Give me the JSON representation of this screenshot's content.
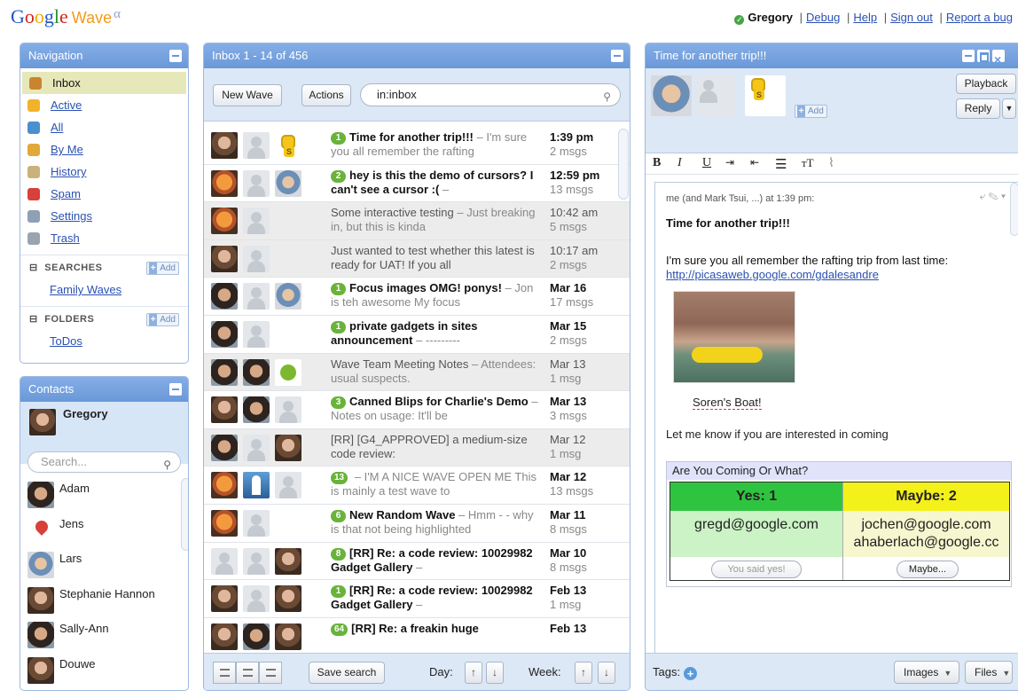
{
  "app": {
    "logo": {
      "g1": "G",
      "g2": "o",
      "g3": "o",
      "g4": "g",
      "g5": "l",
      "g6": "e",
      "wave": "Wave",
      "alpha": "α"
    },
    "user": "Gregory",
    "links": [
      "Debug",
      "Help",
      "Sign out",
      "Report a bug"
    ]
  },
  "nav": {
    "title": "Navigation",
    "items": [
      {
        "label": "Inbox",
        "icon": "inbox-icon",
        "color": "#c8842e"
      },
      {
        "label": "Active",
        "icon": "lightning-icon",
        "color": "#f2b32a"
      },
      {
        "label": "All",
        "icon": "globe-icon",
        "color": "#4a90d0"
      },
      {
        "label": "By Me",
        "icon": "pencil-icon",
        "color": "#e0a93a"
      },
      {
        "label": "History",
        "icon": "clock-icon",
        "color": "#c9b37a"
      },
      {
        "label": "Spam",
        "icon": "no-entry-icon",
        "color": "#d8403a"
      },
      {
        "label": "Settings",
        "icon": "wrench-icon",
        "color": "#8fa0b6"
      },
      {
        "label": "Trash",
        "icon": "trash-icon",
        "color": "#9aa4ae"
      }
    ],
    "searches_label": "SEARCHES",
    "searches": [
      "Family Waves"
    ],
    "folders_label": "FOLDERS",
    "folders": [
      "ToDos"
    ],
    "add_label": "Add"
  },
  "contacts": {
    "title": "Contacts",
    "me": "Gregory",
    "search_placeholder": "Search...",
    "list": [
      "Adam",
      "Jens",
      "Lars",
      "Stephanie Hannon",
      "Sally-Ann",
      "Douwe"
    ]
  },
  "inbox": {
    "title": "Inbox 1 - 14 of 456",
    "new_wave": "New Wave",
    "actions": "Actions",
    "query": "in:inbox",
    "waves": [
      {
        "badge": "1",
        "title": "Time for another trip!!!",
        "snippet": " – I'm sure you all remember the rafting",
        "time": "1:39 pm",
        "msgs": "2 msgs",
        "read": false
      },
      {
        "badge": "2",
        "title": "hey is this the demo of cursors? I can't see a cursor :(",
        "snippet": " –",
        "time": "12:59 pm",
        "msgs": "13 msgs",
        "read": false
      },
      {
        "badge": "",
        "title": "Some interactive testing",
        "snippet": " – Just breaking in, but this is kinda",
        "time": "10:42 am",
        "msgs": "5 msgs",
        "read": true
      },
      {
        "badge": "",
        "title": "Just wanted to test whether this latest is ready for UAT! If you all",
        "snippet": "",
        "time": "10:17 am",
        "msgs": "2 msgs",
        "read": true
      },
      {
        "badge": "1",
        "title": "Focus images OMG! ponys!",
        "snippet": " – Jon is teh awesome My focus",
        "time": "Mar 16",
        "msgs": "17 msgs",
        "read": false
      },
      {
        "badge": "1",
        "title": "private gadgets in sites announcement",
        "snippet": " – ---------",
        "time": "Mar 15",
        "msgs": "2 msgs",
        "read": false
      },
      {
        "badge": "",
        "title": "Wave Team Meeting Notes",
        "snippet": " – Attendees: usual suspects.",
        "time": "Mar 13",
        "msgs": "1 msg",
        "read": true
      },
      {
        "badge": "3",
        "title": "Canned Blips for Charlie's Demo",
        "snippet": " – Notes on usage: It'll be",
        "time": "Mar 13",
        "msgs": "3 msgs",
        "read": false
      },
      {
        "badge": "",
        "title": "[RR] [G4_APPROVED] a medium-size code review:",
        "snippet": "",
        "time": "Mar 12",
        "msgs": "1 msg",
        "read": true
      },
      {
        "badge": "13",
        "title": "",
        "snippet": " – I'M A NICE WAVE OPEN ME This is mainly a test wave to",
        "time": "Mar 12",
        "msgs": "13 msgs",
        "read": false
      },
      {
        "badge": "6",
        "title": "New Random Wave",
        "snippet": " – Hmm - - why is that not being highlighted",
        "time": "Mar 11",
        "msgs": "8 msgs",
        "read": false
      },
      {
        "badge": "8",
        "title": "[RR] Re: a code review: 10029982 Gadget Gallery",
        "snippet": " –",
        "time": "Mar 10",
        "msgs": "8 msgs",
        "read": false
      },
      {
        "badge": "1",
        "title": "[RR] Re: a code review: 10029982 Gadget Gallery",
        "snippet": " –",
        "time": "Feb 13",
        "msgs": "1 msg",
        "read": false
      },
      {
        "badge": "64",
        "title": "[RR] Re: a freakin huge",
        "snippet": "",
        "time": "Feb 13",
        "msgs": "",
        "read": false
      }
    ],
    "save_search": "Save search",
    "day_label": "Day:",
    "week_label": "Week:"
  },
  "wave": {
    "title": "Time for another trip!!!",
    "add_label": "Add",
    "playback": "Playback",
    "reply": "Reply",
    "fmt": {
      "bold": "B",
      "italic": "I",
      "underline": "U",
      "size": "тT"
    },
    "blip_header": "me (and Mark Tsui, ...) at 1:39 pm:",
    "blip_title": "Time for another trip!!!",
    "body_text": "I'm sure you all remember the rafting trip from last time:",
    "link": "http://picasaweb.google.com/gdalesandre",
    "caption": "Soren's Boat!",
    "closing": "Let me know if you are interested in coming",
    "poll": {
      "title": "Are You Coming Or What?",
      "yes_header": "Yes: 1",
      "maybe_header": "Maybe: 2",
      "yes_people": [
        "gregd@google.com"
      ],
      "maybe_people": [
        "jochen@google.com",
        "ahaberlach@google.cc"
      ],
      "yes_button": "You said yes!",
      "maybe_button": "Maybe...",
      "yes_color": "#2fc440",
      "maybe_color": "#f4f01a",
      "yes_body_color": "#cbf3c5",
      "maybe_body_color": "#f6f6cf"
    },
    "tags_label": "Tags:",
    "images": "Images",
    "files": "Files"
  }
}
